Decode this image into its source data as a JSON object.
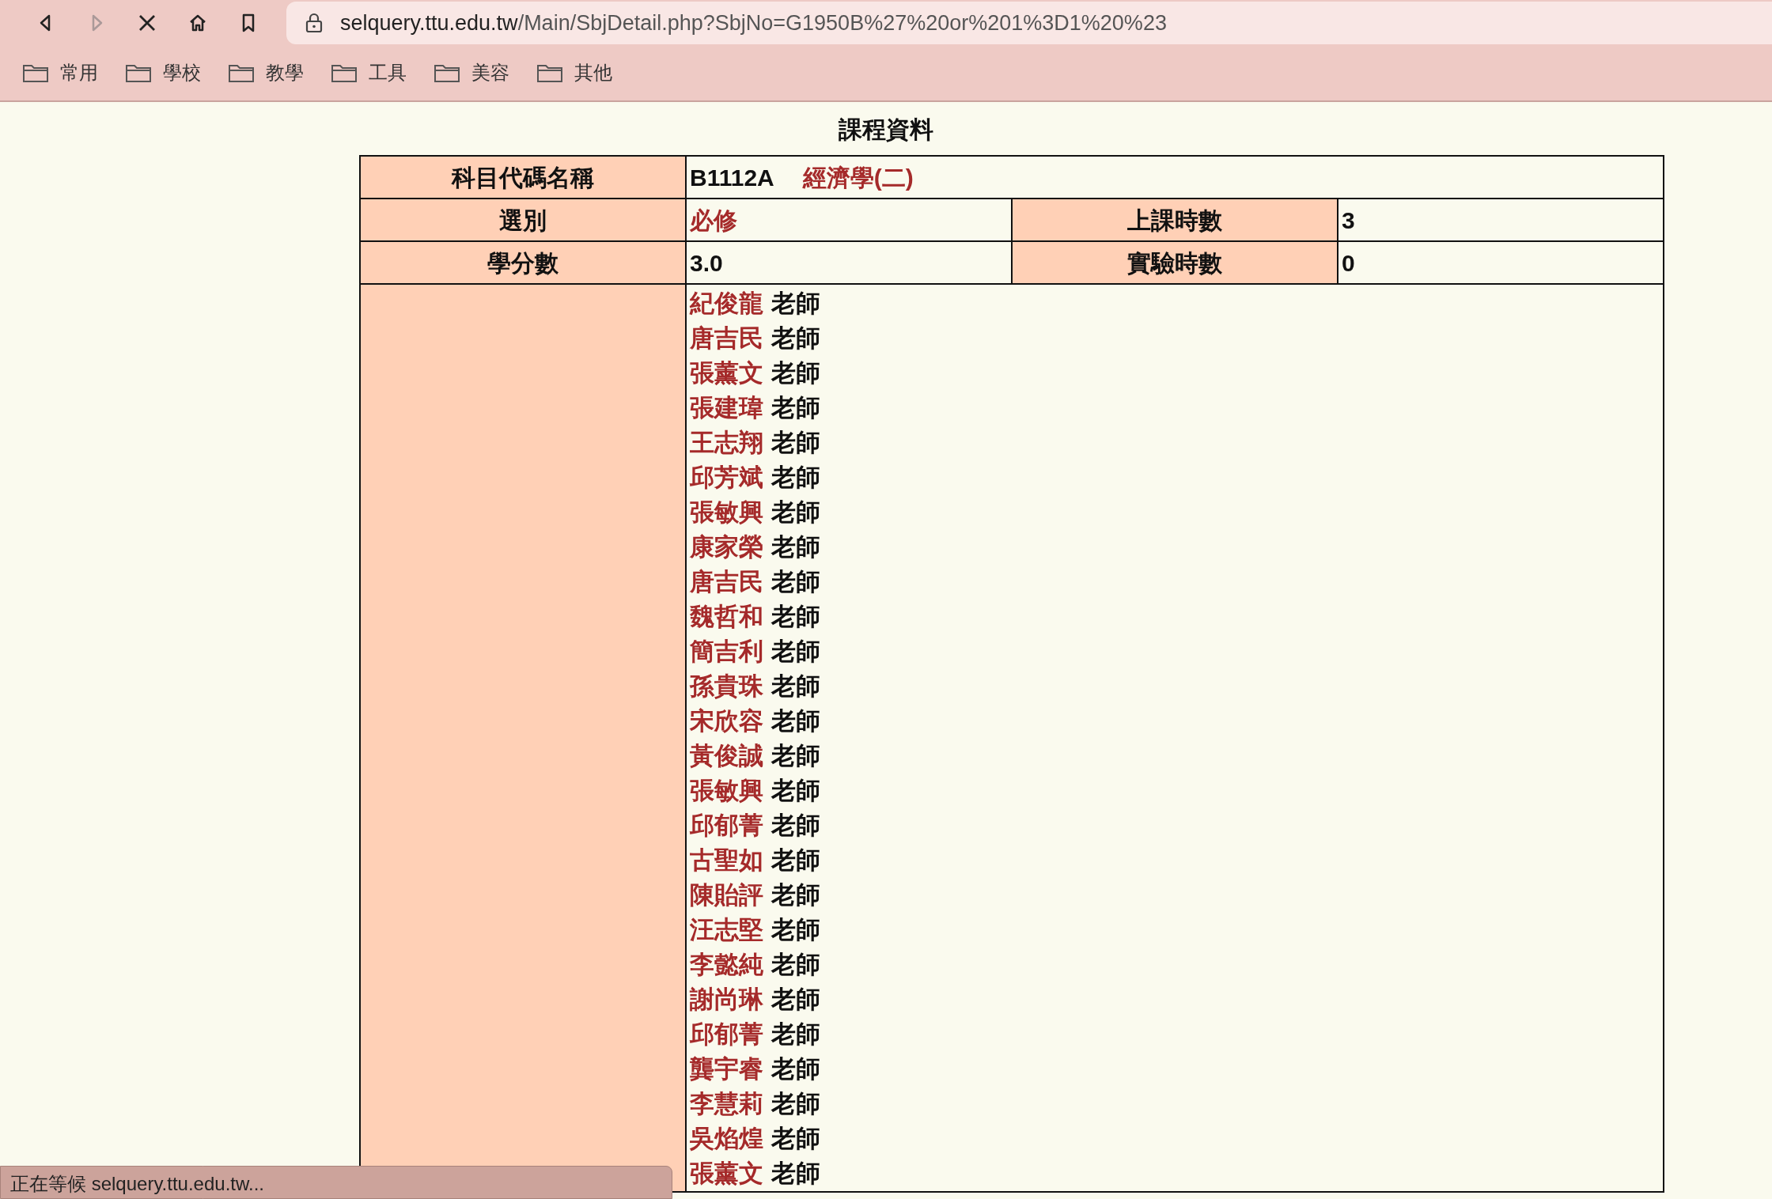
{
  "browser": {
    "nav_buttons": [
      {
        "kind": "back",
        "disabled": false
      },
      {
        "kind": "forward",
        "disabled": true
      },
      {
        "kind": "stop",
        "disabled": false
      },
      {
        "kind": "home",
        "disabled": false
      },
      {
        "kind": "bookmark",
        "disabled": false
      }
    ],
    "address": {
      "host": "selquery.ttu.edu.tw",
      "path": "/Main/SbjDetail.php?SbjNo=G1950B%27%20or%201%3D1%20%23"
    },
    "bookmarks": [
      "常用",
      "學校",
      "教學",
      "工具",
      "美容",
      "其他"
    ]
  },
  "page": {
    "title": "課程資料",
    "course": {
      "label": "科目代碼名稱",
      "code": "B1112A",
      "name": "經濟學(二)"
    },
    "rows": [
      [
        {
          "label": "選別",
          "value": "必修",
          "kind": "highlight"
        },
        {
          "label": "上課時數",
          "value": "3",
          "kind": "plain"
        }
      ],
      [
        {
          "label": "學分數",
          "value": "3.0",
          "kind": "plain"
        },
        {
          "label": "實驗時數",
          "value": "0",
          "kind": "plain"
        }
      ]
    ],
    "teachers": [
      {
        "name": "紀俊龍",
        "suffix": "老師"
      },
      {
        "name": "唐吉民",
        "suffix": "老師"
      },
      {
        "name": "張薰文",
        "suffix": "老師"
      },
      {
        "name": "張建瑋",
        "suffix": "老師"
      },
      {
        "name": "王志翔",
        "suffix": "老師"
      },
      {
        "name": "邱芳斌",
        "suffix": "老師"
      },
      {
        "name": "張敏興",
        "suffix": "老師"
      },
      {
        "name": "康家榮",
        "suffix": "老師"
      },
      {
        "name": "唐吉民",
        "suffix": "老師"
      },
      {
        "name": "魏哲和",
        "suffix": "老師"
      },
      {
        "name": "簡吉利",
        "suffix": "老師"
      },
      {
        "name": "孫貴珠",
        "suffix": "老師"
      },
      {
        "name": "宋欣容",
        "suffix": "老師"
      },
      {
        "name": "黃俊誠",
        "suffix": "老師"
      },
      {
        "name": "張敏興",
        "suffix": "老師"
      },
      {
        "name": "邱郁菁",
        "suffix": "老師"
      },
      {
        "name": "古聖如",
        "suffix": "老師"
      },
      {
        "name": "陳貽評",
        "suffix": "老師"
      },
      {
        "name": "汪志堅",
        "suffix": "老師"
      },
      {
        "name": "李懿純",
        "suffix": "老師"
      },
      {
        "name": "謝尚琳",
        "suffix": "老師"
      },
      {
        "name": "邱郁菁",
        "suffix": "老師"
      },
      {
        "name": "龔宇睿",
        "suffix": "老師"
      },
      {
        "name": "李慧莉",
        "suffix": "老師"
      },
      {
        "name": "吳焰煌",
        "suffix": "老師"
      },
      {
        "name": "張薰文",
        "suffix": "老師"
      }
    ]
  },
  "status_bar": "正在等候 selquery.ttu.edu.tw..."
}
